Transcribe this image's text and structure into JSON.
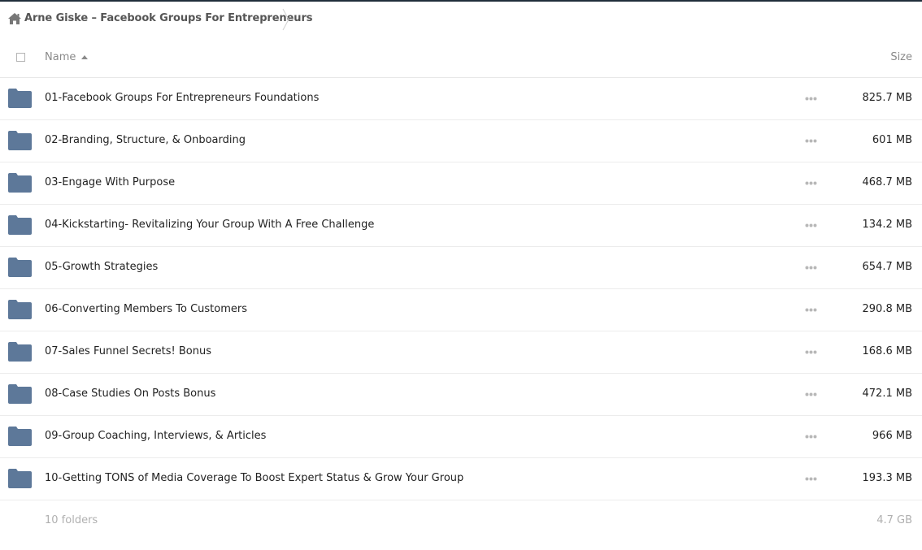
{
  "breadcrumb": {
    "home_icon": "home-icon",
    "title": "Arne Giske – Facebook Groups For Entrepreneurs"
  },
  "header": {
    "name_label": "Name",
    "size_label": "Size",
    "sort_icon": "sort-ascending-icon"
  },
  "colors": {
    "folder": "#5d7899",
    "text": "#222222",
    "muted": "#b0b0b0"
  },
  "rows": [
    {
      "name": "01-Facebook Groups For Entrepreneurs Foundations",
      "size": "825.7 MB",
      "icon": "folder-icon"
    },
    {
      "name": "02-Branding, Structure, & Onboarding",
      "size": "601 MB",
      "icon": "folder-icon"
    },
    {
      "name": "03-Engage With Purpose",
      "size": "468.7 MB",
      "icon": "folder-icon"
    },
    {
      "name": "04-Kickstarting- Revitalizing Your Group With A Free Challenge",
      "size": "134.2 MB",
      "icon": "folder-icon"
    },
    {
      "name": "05-Growth Strategies",
      "size": "654.7 MB",
      "icon": "folder-icon"
    },
    {
      "name": "06-Converting Members To Customers",
      "size": "290.8 MB",
      "icon": "folder-icon"
    },
    {
      "name": "07-Sales Funnel Secrets! Bonus",
      "size": "168.6 MB",
      "icon": "folder-icon"
    },
    {
      "name": "08-Case Studies On Posts Bonus",
      "size": "472.1 MB",
      "icon": "folder-icon"
    },
    {
      "name": "09-Group Coaching, Interviews, & Articles",
      "size": "966 MB",
      "icon": "folder-icon"
    },
    {
      "name": "10-Getting TONS of Media Coverage To Boost Expert Status & Grow Your Group",
      "size": "193.3 MB",
      "icon": "folder-icon"
    }
  ],
  "footer": {
    "count": "10 folders",
    "total": "4.7 GB"
  }
}
